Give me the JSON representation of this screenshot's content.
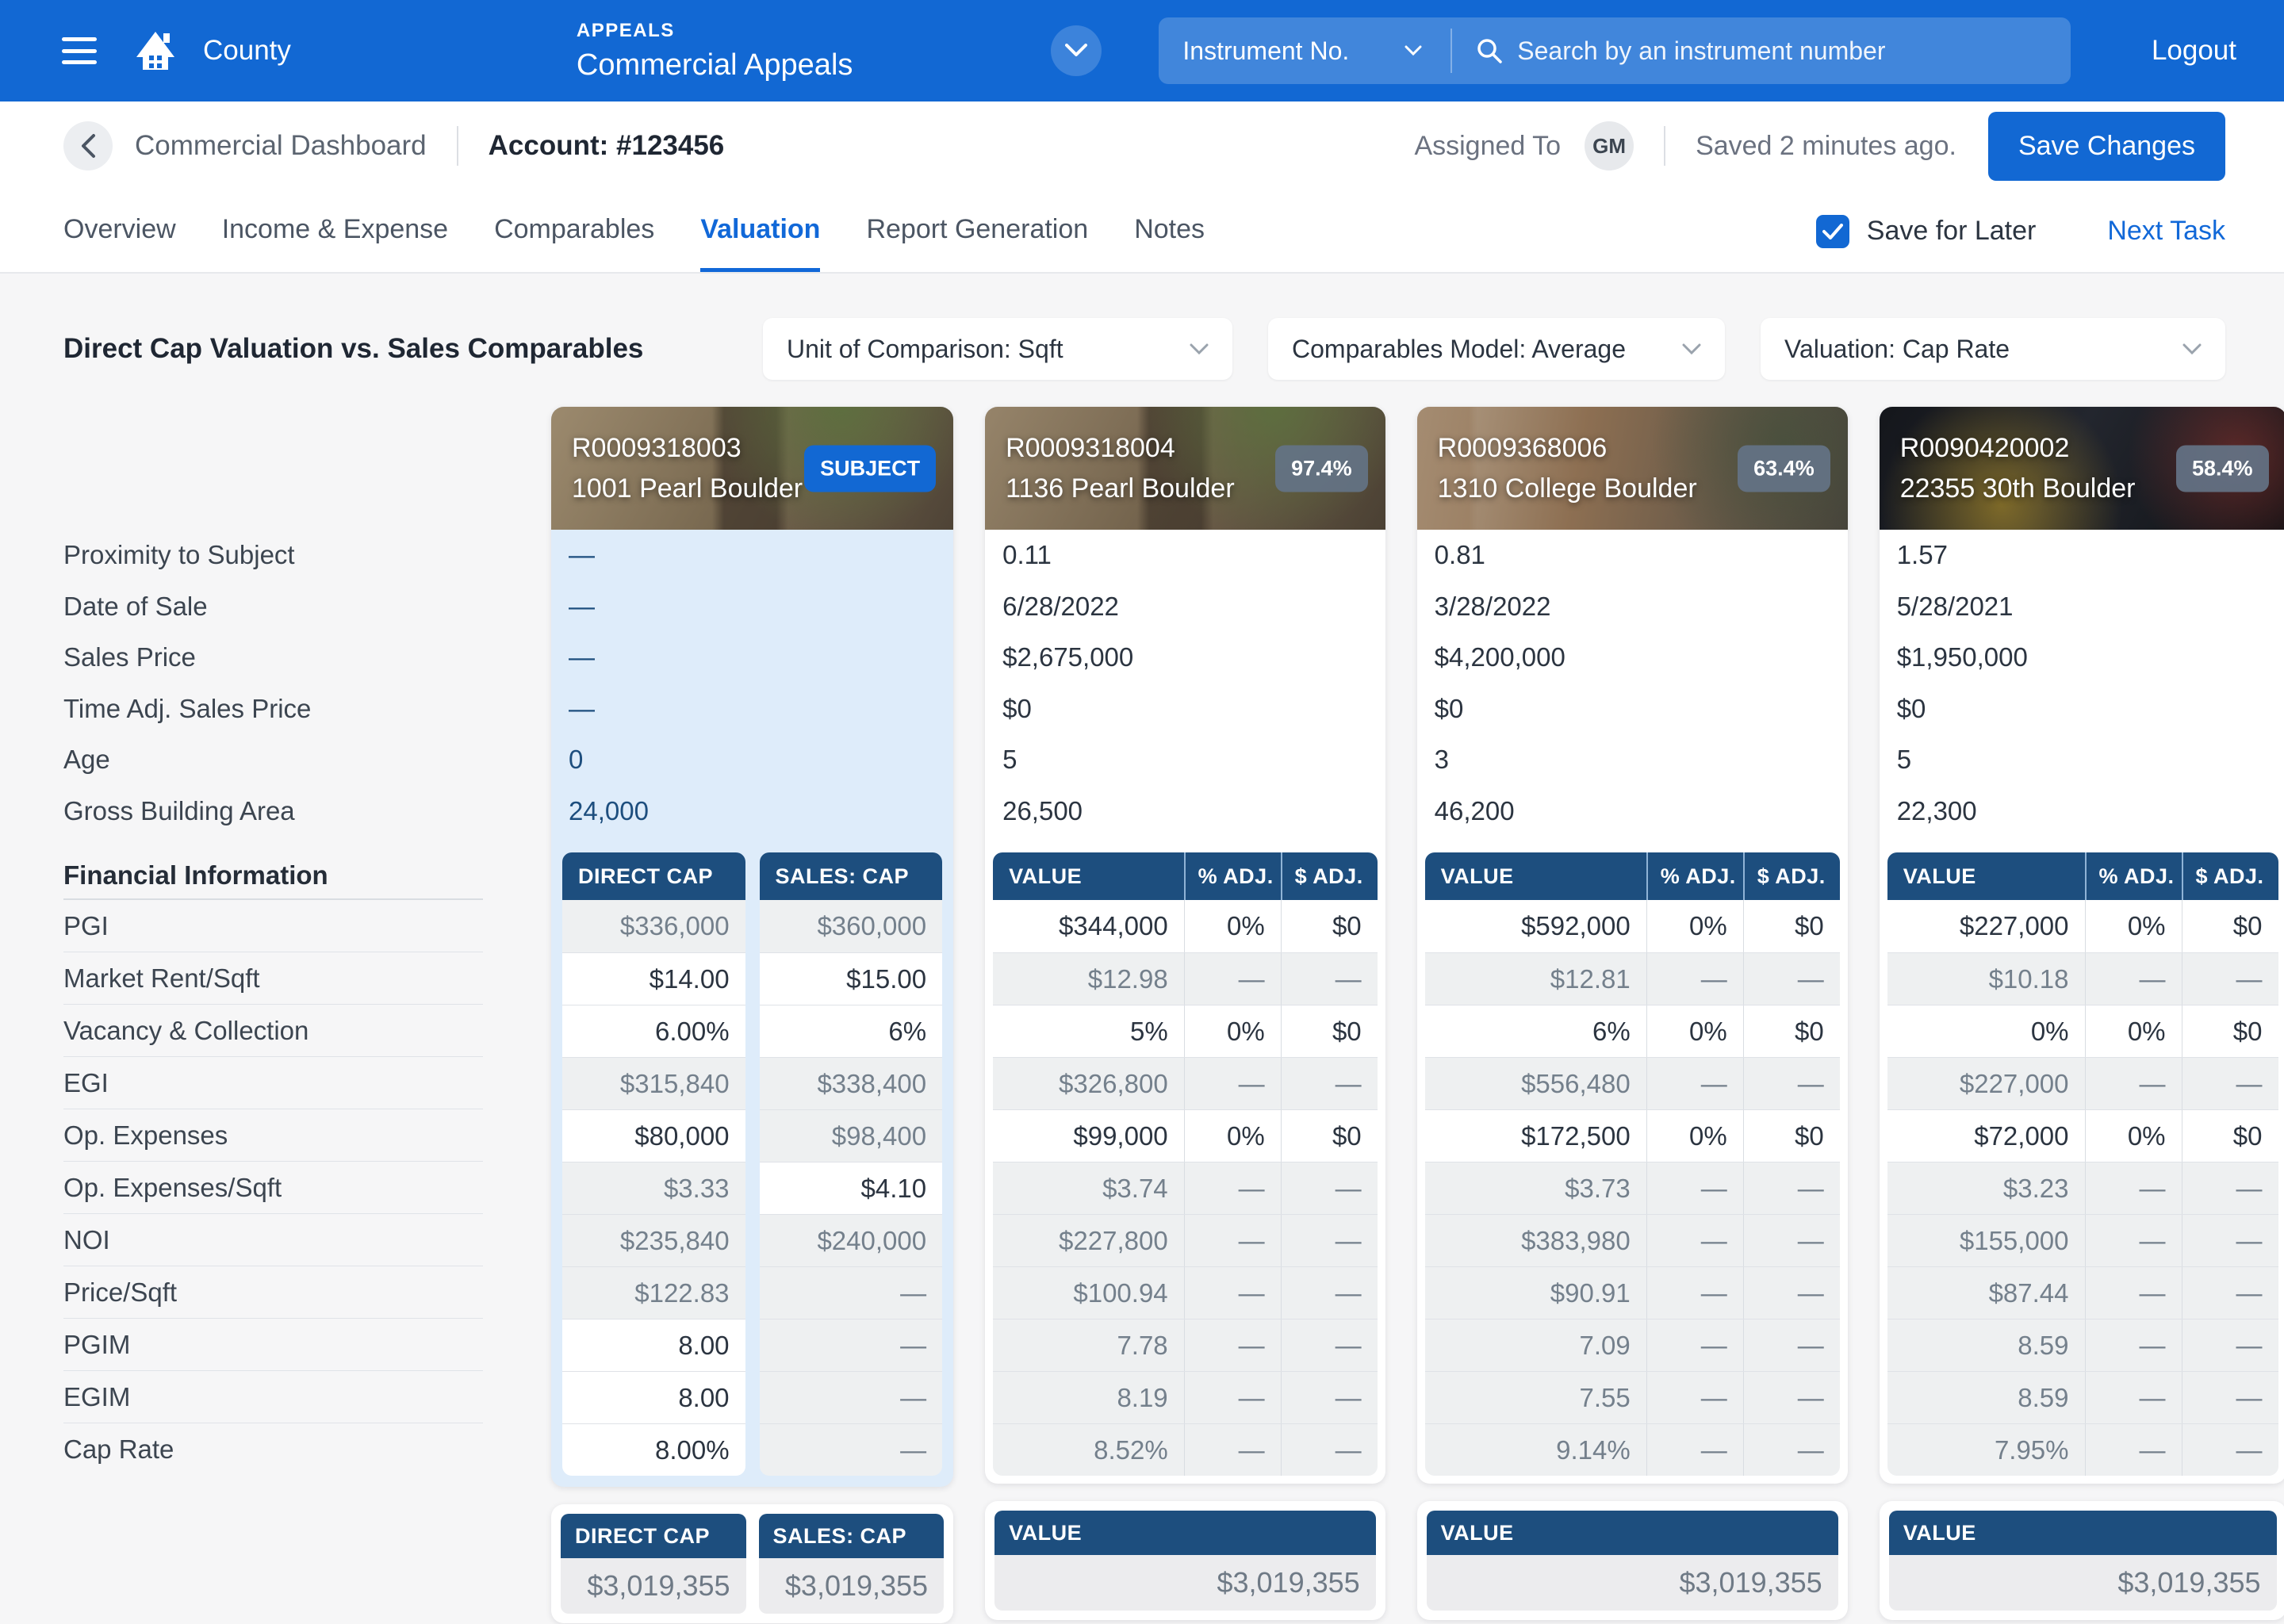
{
  "colors": {
    "accent": "#1268d3",
    "navy": "#1d4e7e",
    "subject_tint": "#deecfa"
  },
  "nav": {
    "app_name": "County",
    "section_label": "APPEALS",
    "section_title": "Commercial Appeals",
    "search_category": "Instrument No.",
    "search_placeholder": "Search by an instrument number",
    "logout_label": "Logout"
  },
  "header": {
    "back_label": "Commercial Dashboard",
    "account_label": "Account: #123456",
    "assigned_to_label": "Assigned To",
    "avatar_initials": "GM",
    "saved_status": "Saved 2 minutes ago.",
    "save_button": "Save Changes"
  },
  "tabs": {
    "items": [
      "Overview",
      "Income & Expense",
      "Comparables",
      "Valuation",
      "Report Generation",
      "Notes"
    ],
    "active": "Valuation",
    "save_for_later": "Save for Later",
    "next_task": "Next Task"
  },
  "toolbar": {
    "title": "Direct Cap Valuation vs. Sales Comparables",
    "dropdown_unit": "Unit of Comparison: Sqft",
    "dropdown_model": "Comparables Model: Average",
    "dropdown_valuation": "Valuation: Cap Rate"
  },
  "labels": {
    "info": [
      "Proximity to Subject",
      "Date of Sale",
      "Sales Price",
      "Time Adj. Sales Price",
      "Age",
      "Gross Building Area"
    ],
    "financial_header": "Financial Information",
    "financial": [
      "PGI",
      "Market Rent/Sqft",
      "Vacancy & Collection",
      "EGI",
      "Op. Expenses",
      "Op. Expenses/Sqft",
      "NOI",
      "Price/Sqft",
      "PGIM",
      "EGIM",
      "Cap Rate"
    ]
  },
  "subject": {
    "id": "R0009318003",
    "address": "1001 Pearl Boulder",
    "badge": "SUBJECT",
    "info": [
      "—",
      "—",
      "—",
      "—",
      "0",
      "24,000"
    ],
    "col_direct": "DIRECT CAP",
    "col_sales": "SALES: CAP",
    "direct_cap": [
      "$336,000",
      "$14.00",
      "6.00%",
      "$315,840",
      "$80,000",
      "$3.33",
      "$235,840",
      "$122.83",
      "8.00",
      "8.00",
      "8.00%"
    ],
    "sales_cap": [
      "$360,000",
      "$15.00",
      "6%",
      "$338,400",
      "$98,400",
      "$4.10",
      "$240,000",
      "—",
      "—",
      "—",
      "—"
    ],
    "footer": [
      {
        "label": "DIRECT CAP",
        "value": "$3,019,355"
      },
      {
        "label": "SALES: CAP",
        "value": "$3,019,355"
      }
    ]
  },
  "comp_columns": {
    "value": "VALUE",
    "pct": "% ADJ.",
    "dollar": "$ ADJ."
  },
  "comps": [
    {
      "id": "R0009318004",
      "address": "1136 Pearl Boulder",
      "badge": "97.4%",
      "info": [
        "0.11",
        "6/28/2022",
        "$2,675,000",
        "$0",
        "5",
        "26,500"
      ],
      "rows": [
        [
          "$344,000",
          "0%",
          "$0"
        ],
        [
          "$12.98",
          "—",
          "—"
        ],
        [
          "5%",
          "0%",
          "$0"
        ],
        [
          "$326,800",
          "—",
          "—"
        ],
        [
          "$99,000",
          "0%",
          "$0"
        ],
        [
          "$3.74",
          "—",
          "—"
        ],
        [
          "$227,800",
          "—",
          "—"
        ],
        [
          "$100.94",
          "—",
          "—"
        ],
        [
          "7.78",
          "—",
          "—"
        ],
        [
          "8.19",
          "—",
          "—"
        ],
        [
          "8.52%",
          "—",
          "—"
        ]
      ],
      "footer": {
        "label": "VALUE",
        "value": "$3,019,355"
      }
    },
    {
      "id": "R0009368006",
      "address": "1310 College Boulder",
      "badge": "63.4%",
      "info": [
        "0.81",
        "3/28/2022",
        "$4,200,000",
        "$0",
        "3",
        "46,200"
      ],
      "rows": [
        [
          "$592,000",
          "0%",
          "$0"
        ],
        [
          "$12.81",
          "—",
          "—"
        ],
        [
          "6%",
          "0%",
          "$0"
        ],
        [
          "$556,480",
          "—",
          "—"
        ],
        [
          "$172,500",
          "0%",
          "$0"
        ],
        [
          "$3.73",
          "—",
          "—"
        ],
        [
          "$383,980",
          "—",
          "—"
        ],
        [
          "$90.91",
          "—",
          "—"
        ],
        [
          "7.09",
          "—",
          "—"
        ],
        [
          "7.55",
          "—",
          "—"
        ],
        [
          "9.14%",
          "—",
          "—"
        ]
      ],
      "footer": {
        "label": "VALUE",
        "value": "$3,019,355"
      }
    },
    {
      "id": "R0090420002",
      "address": "22355 30th Boulder",
      "badge": "58.4%",
      "info": [
        "1.57",
        "5/28/2021",
        "$1,950,000",
        "$0",
        "5",
        "22,300"
      ],
      "rows": [
        [
          "$227,000",
          "0%",
          "$0"
        ],
        [
          "$10.18",
          "—",
          "—"
        ],
        [
          "0%",
          "0%",
          "$0"
        ],
        [
          "$227,000",
          "—",
          "—"
        ],
        [
          "$72,000",
          "0%",
          "$0"
        ],
        [
          "$3.23",
          "—",
          "—"
        ],
        [
          "$155,000",
          "—",
          "—"
        ],
        [
          "$87.44",
          "—",
          "—"
        ],
        [
          "8.59",
          "—",
          "—"
        ],
        [
          "8.59",
          "—",
          "—"
        ],
        [
          "7.95%",
          "—",
          "—"
        ]
      ],
      "footer": {
        "label": "VALUE",
        "value": "$3,019,355"
      }
    }
  ]
}
